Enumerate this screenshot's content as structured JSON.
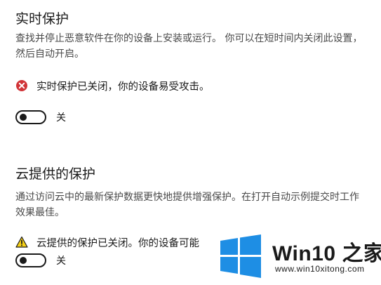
{
  "realtime": {
    "title": "实时保护",
    "description": "查找并停止恶意软件在你的设备上安装或运行。 你可以在短时间内关闭此设置，然后自动开启。",
    "status": "实时保护已关闭，你的设备易受攻击。",
    "status_icon": "error-x-icon",
    "toggle_label": "关",
    "toggle_state": "off"
  },
  "cloud": {
    "title": "云提供的保护",
    "description": "通过访问云中的最新保护数据更快地提供增强保护。在打开自动示例提交时工作效果最佳。",
    "status": "云提供的保护已关闭。你的设备可能",
    "status_icon": "warning-icon",
    "toggle_label": "关",
    "toggle_state": "off"
  },
  "watermark": {
    "brand_prefix": "Win10",
    "brand_suffix": "之家",
    "url": "www.win10xitong.com",
    "logo": "windows-logo"
  },
  "colors": {
    "error": "#d13438",
    "warning": "#f7d117",
    "windows_blue": "#1e8ee4"
  }
}
